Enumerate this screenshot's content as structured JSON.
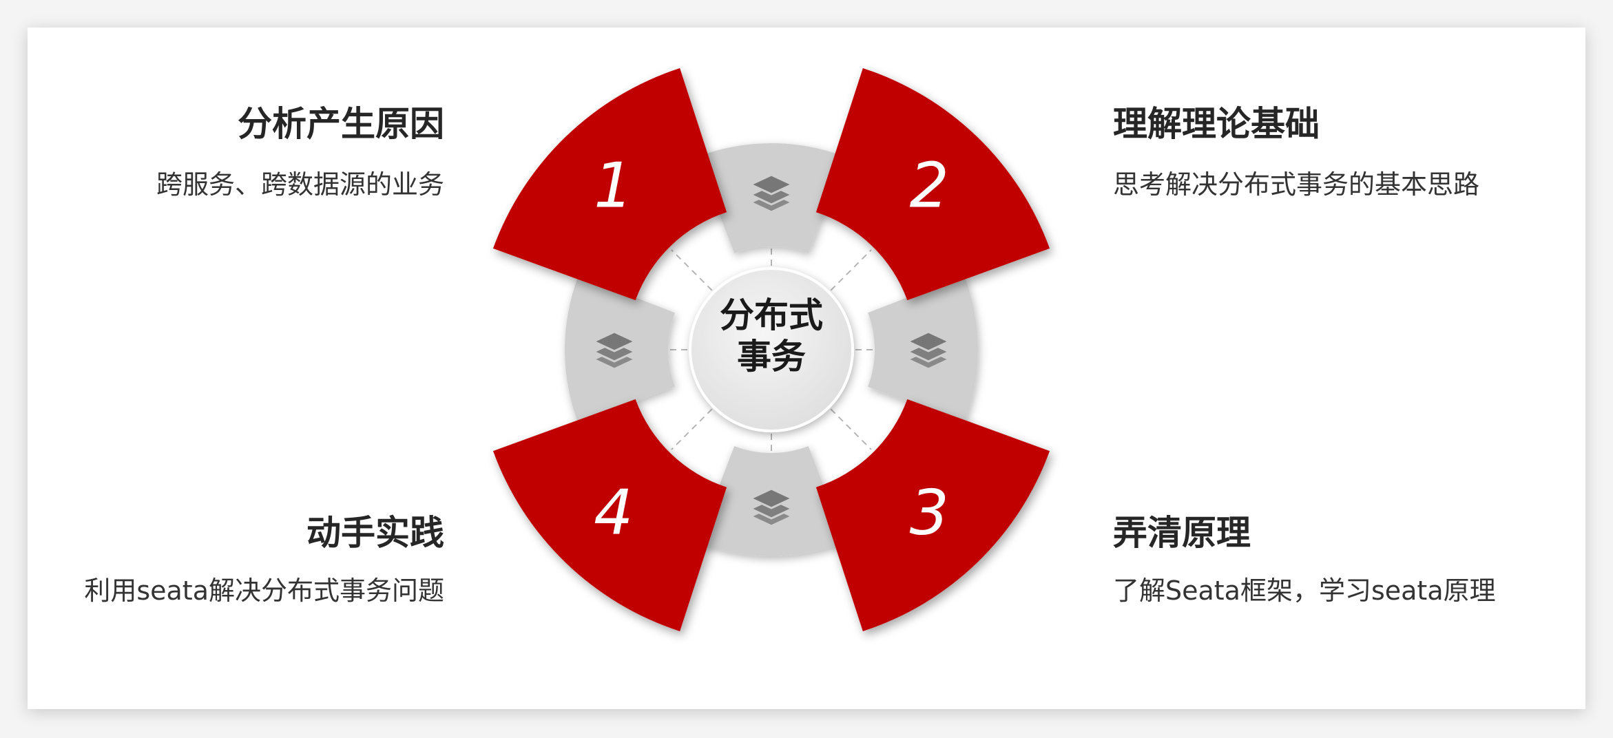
{
  "center": {
    "line1": "分布式",
    "line2": "事务"
  },
  "items": [
    {
      "number": "1",
      "title": "分析产生原因",
      "desc": "跨服务、跨数据源的业务"
    },
    {
      "number": "2",
      "title": "理解理论基础",
      "desc": "思考解决分布式事务的基本思路"
    },
    {
      "number": "3",
      "title": "弄清原理",
      "desc": "了解Seata框架，学习seata原理"
    },
    {
      "number": "4",
      "title": "动手实践",
      "desc": "利用seata解决分布式事务问题"
    }
  ],
  "colors": {
    "accent_red": "#c00000",
    "gray_segment": "#cfcfcf",
    "layer_icon": "#777777",
    "center_fill": "#ececec"
  },
  "icons": [
    "layers-icon"
  ]
}
